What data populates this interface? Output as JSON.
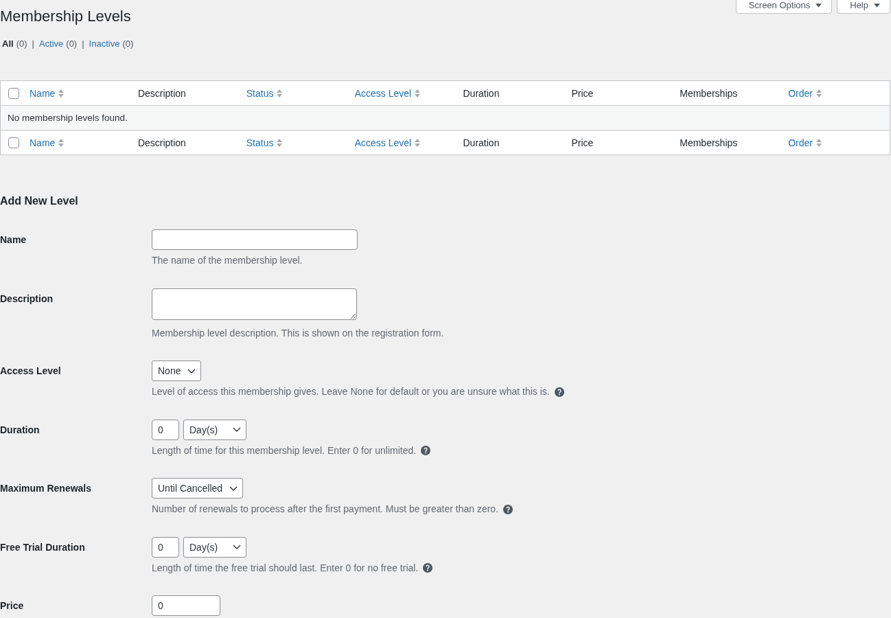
{
  "screen_meta": {
    "buttons": [
      {
        "label": "Screen Options"
      },
      {
        "label": "Help"
      }
    ]
  },
  "title": "Membership Levels",
  "filters": [
    {
      "label": "All",
      "count": "(0)",
      "selected": true
    },
    {
      "separator": "|",
      "label": "Active",
      "count": "(0)",
      "selected": false
    },
    {
      "separator": "|",
      "label": "Inactive",
      "count": "(0)",
      "selected": false
    }
  ],
  "table": {
    "header": {
      "select_all": {
        "checked": false
      },
      "columns": [
        {
          "label": "Name",
          "sortable": true
        },
        {
          "label": "Description",
          "sortable": false
        },
        {
          "label": "Status",
          "sortable": true
        },
        {
          "label": "Access Level",
          "sortable": true
        },
        {
          "label": "Duration",
          "sortable": false
        },
        {
          "label": "Price",
          "sortable": false
        },
        {
          "label": "Memberships",
          "sortable": false
        },
        {
          "label": "Order",
          "sortable": true
        }
      ]
    },
    "empty_message": "No membership levels found.",
    "footer": {
      "select_all": {
        "checked": false
      },
      "columns": [
        {
          "label": "Name",
          "sortable": true
        },
        {
          "label": "Description",
          "sortable": false
        },
        {
          "label": "Status",
          "sortable": true
        },
        {
          "label": "Access Level",
          "sortable": true
        },
        {
          "label": "Duration",
          "sortable": false
        },
        {
          "label": "Price",
          "sortable": false
        },
        {
          "label": "Memberships",
          "sortable": false
        },
        {
          "label": "Order",
          "sortable": true
        }
      ]
    }
  },
  "form": {
    "title": "Add New Level",
    "rows": [
      {
        "label": "Name",
        "controls": [
          {
            "kind": "wide_input"
          }
        ],
        "description": "The name of the membership level."
      },
      {
        "label": "Description",
        "controls": [
          {
            "kind": "textarea"
          }
        ],
        "description": "Membership level description. This is shown on the registration form."
      },
      {
        "label": "Access Level",
        "controls": [
          {
            "kind": "select",
            "value": "None"
          }
        ],
        "description": "Level of access this membership gives. Leave None for default or you are unsure what this is.",
        "help": true
      },
      {
        "label": "Duration",
        "controls": [
          {
            "kind": "tiny_input",
            "value": "0"
          },
          {
            "kind": "select",
            "value": "Day(s)"
          }
        ],
        "description": "Length of time for this membership level. Enter 0 for unlimited.",
        "help": true
      },
      {
        "label": "Maximum Renewals",
        "controls": [
          {
            "kind": "select",
            "value": "Until Cancelled"
          }
        ],
        "description": "Number of renewals to process after the first payment. Must be greater than zero.",
        "help": true
      },
      {
        "label": "Free Trial Duration",
        "controls": [
          {
            "kind": "tiny_input",
            "value": "0"
          },
          {
            "kind": "select",
            "value": "Day(s)"
          }
        ],
        "description": "Length of time the free trial should last. Enter 0 for no free trial.",
        "help": true
      },
      {
        "label": "Price",
        "controls": [
          {
            "kind": "small_input",
            "value": "0"
          }
        ]
      }
    ]
  }
}
